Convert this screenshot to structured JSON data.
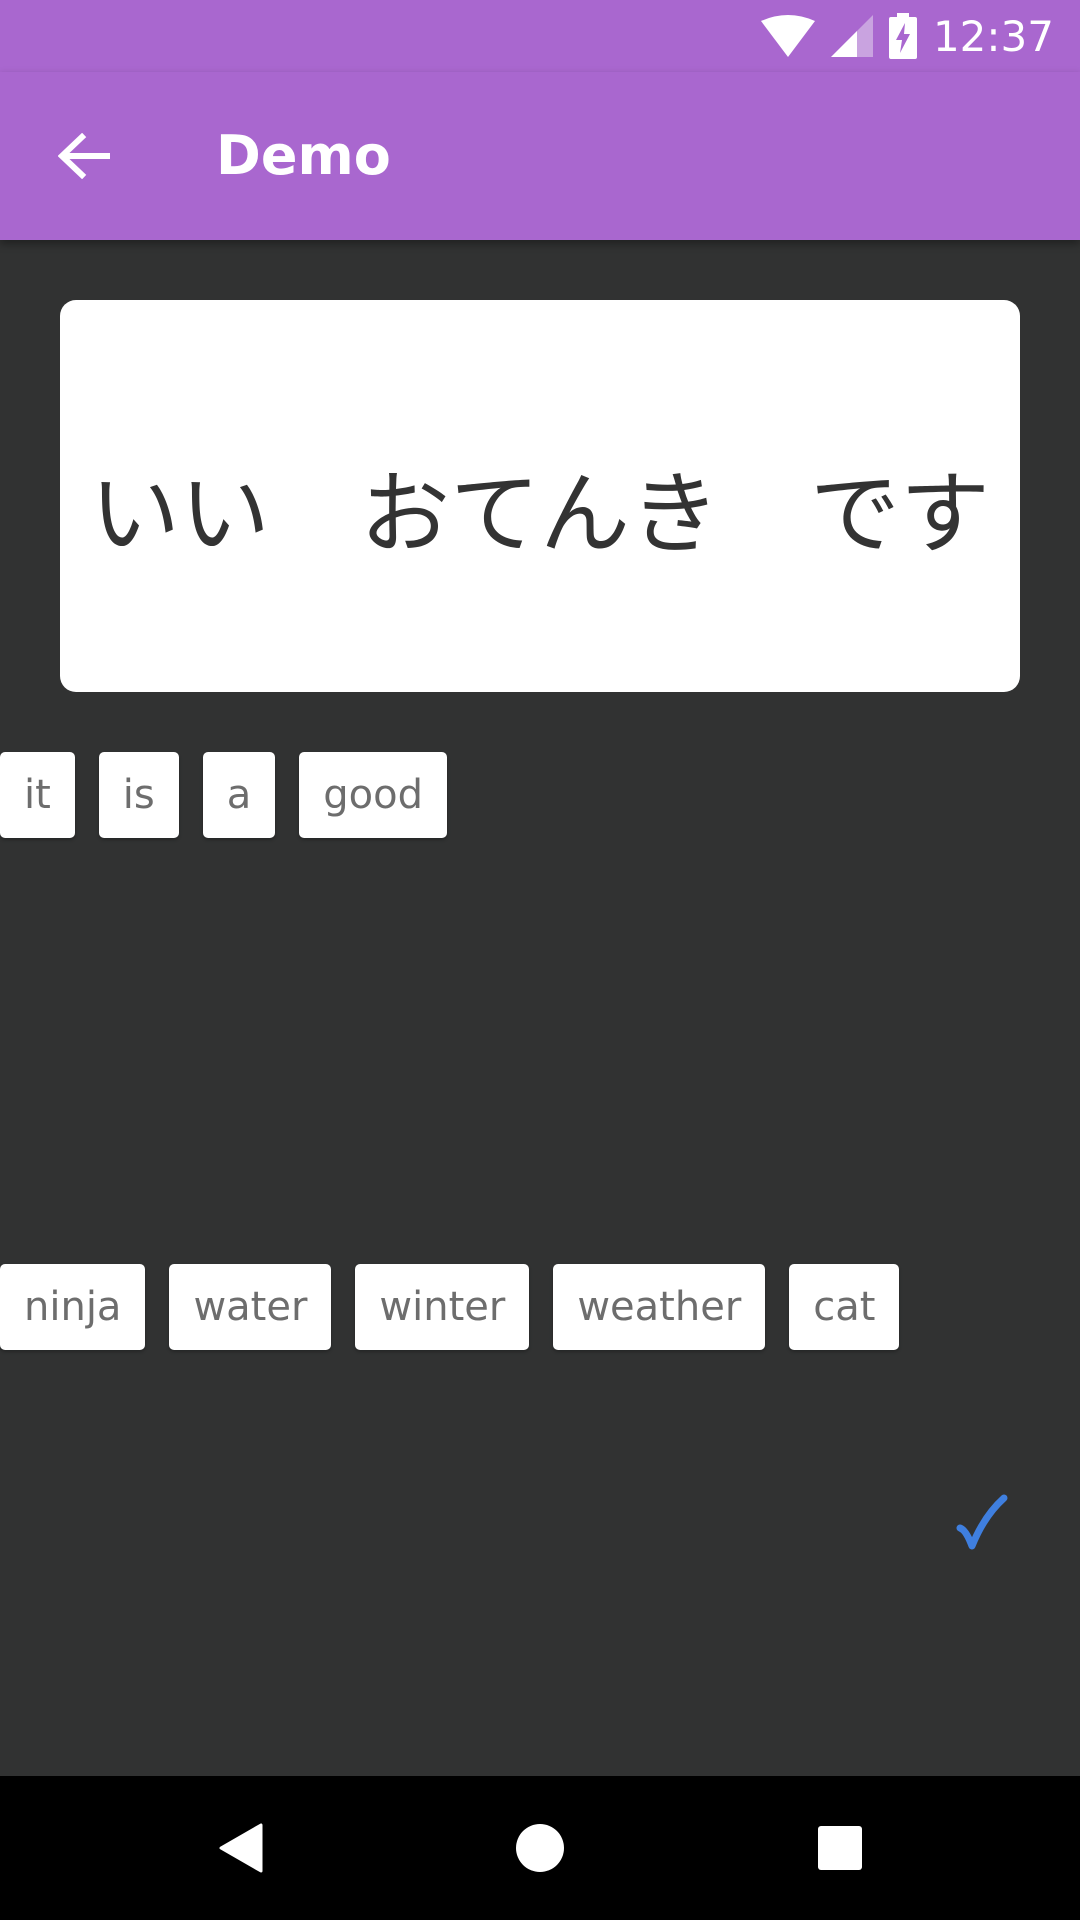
{
  "status_bar": {
    "time": "12:37",
    "icons": [
      "wifi-icon",
      "cell-signal-icon",
      "battery-charging-icon"
    ]
  },
  "app_bar": {
    "back_icon": "arrow-back-icon",
    "title": "Demo"
  },
  "prompt": {
    "text": "いい　おてんき　です"
  },
  "answer_words": [
    "it",
    "is",
    "a",
    "good"
  ],
  "word_bank": [
    "ninja",
    "water",
    "winter",
    "weather",
    "cat"
  ],
  "check": {
    "icon": "checkmark-icon",
    "color": "#3f7fdf"
  },
  "nav_bar": {
    "icons": [
      "nav-back-icon",
      "nav-home-icon",
      "nav-recents-icon"
    ]
  },
  "colors": {
    "primary": "#a967cf",
    "background": "#313232",
    "card": "#ffffff",
    "chip_text": "#6d6d6d"
  }
}
